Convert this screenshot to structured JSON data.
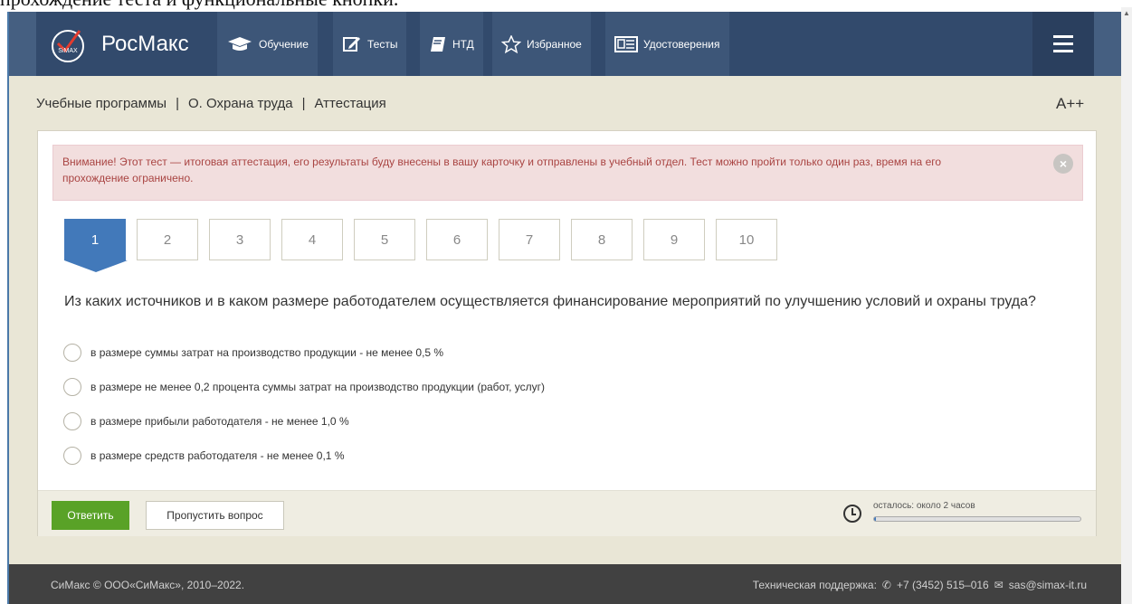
{
  "cut_heading": "прохождение теста и функциональные кнопки.",
  "nav": {
    "brand": "РосМакс",
    "logo_text": "SiMAX",
    "items": [
      {
        "label": "Обучение",
        "icon": "graduation-cap-icon"
      },
      {
        "label": "Тесты",
        "icon": "edit-icon"
      },
      {
        "label": "НТД",
        "icon": "book-icon"
      },
      {
        "label": "Избранное",
        "icon": "star-icon"
      },
      {
        "label": "Удостоверения",
        "icon": "certificate-icon"
      }
    ],
    "menu_icon": "hamburger-icon"
  },
  "breadcrumb": [
    "Учебные программы",
    "О. Охрана труда",
    "Аттестация"
  ],
  "breadcrumb_sep": "|",
  "font_size_button": "A++",
  "alert": {
    "strong": "Внимание!",
    "text": " Этот тест — итоговая аттестация, его результаты буду внесены в вашу карточку и отправлены в учебный отдел. Тест можно пройти только один раз, время на его прохождение ограничено.",
    "close_icon": "close-icon"
  },
  "question_numbers": [
    "1",
    "2",
    "3",
    "4",
    "5",
    "6",
    "7",
    "8",
    "9",
    "10"
  ],
  "active_question": "1",
  "question": "Из каких источников и в каком размере работодателем осуществляется финансирование мероприятий по улучшению условий и охраны труда?",
  "options": [
    "в размере суммы затрат на производство продукции - не менее 0,5 %",
    "в размере не менее 0,2 процента суммы затрат на производство продукции (работ, услуг)",
    "в размере прибыли работодателя - не менее 1,0 %",
    "в размере средств работодателя - не менее 0,1 %"
  ],
  "buttons": {
    "answer": "Ответить",
    "skip": "Пропустить вопрос"
  },
  "timer": {
    "text": "осталось: около 2 часов",
    "progress": 0.01,
    "icon": "clock-icon"
  },
  "footer": {
    "copyright": "СиМакс © ООО«СиМакс», 2010–2022.",
    "support_label": "Техническая поддержка:",
    "phone": "+7 (3452) 515–016",
    "email": "sas@simax-it.ru"
  },
  "colors": {
    "nav_bg": "#324a6c",
    "active_blue": "#4279ba",
    "answer_green": "#59a227",
    "alert_text": "#a94442",
    "page_bg": "#e9e6d6"
  }
}
